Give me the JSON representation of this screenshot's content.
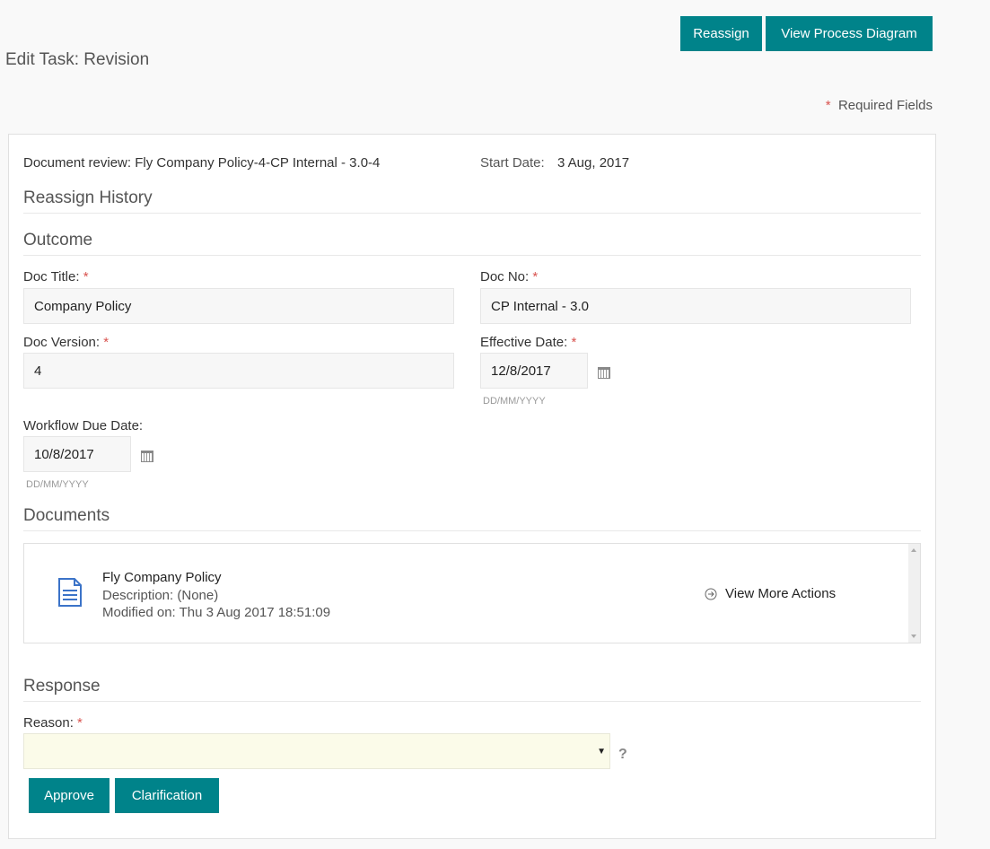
{
  "header": {
    "reassign_label": "Reassign",
    "diagram_label": "View Process Diagram",
    "title": "Edit Task: Revision",
    "required_star": "*",
    "required_label": "Required Fields"
  },
  "task": {
    "document_review": "Document review: Fly Company Policy-4-CP Internal - 3.0-4",
    "start_date_label": "Start Date:",
    "start_date_value": "3 Aug, 2017"
  },
  "sections": {
    "reassign_history": "Reassign History",
    "outcome": "Outcome",
    "documents": "Documents",
    "response": "Response"
  },
  "form": {
    "required_marker": "*",
    "doc_title_label": "Doc Title:",
    "doc_title_value": "Company Policy",
    "doc_no_label": "Doc No:",
    "doc_no_value": "CP Internal - 3.0",
    "doc_version_label": "Doc Version:",
    "doc_version_value": "4",
    "effective_date_label": "Effective Date:",
    "effective_date_value": "12/8/2017",
    "date_hint": "DD/MM/YYYY",
    "workflow_due_label": "Workflow Due Date:",
    "workflow_due_value": "10/8/2017"
  },
  "documents": {
    "name": "Fly Company Policy",
    "description": "Description: (None)",
    "modified": "Modified on: Thu 3 Aug 2017 18:51:09",
    "more_actions": "View More Actions",
    "icon": "document-icon"
  },
  "response": {
    "reason_label": "Reason:",
    "reason_value": "",
    "caret": "▼",
    "help": "?",
    "approve_label": "Approve",
    "clarification_label": "Clarification"
  },
  "colors": {
    "accent": "#00838a",
    "required": "#d9534f",
    "select_bg": "#fbfbe9",
    "doc_icon": "#3b73c8"
  }
}
